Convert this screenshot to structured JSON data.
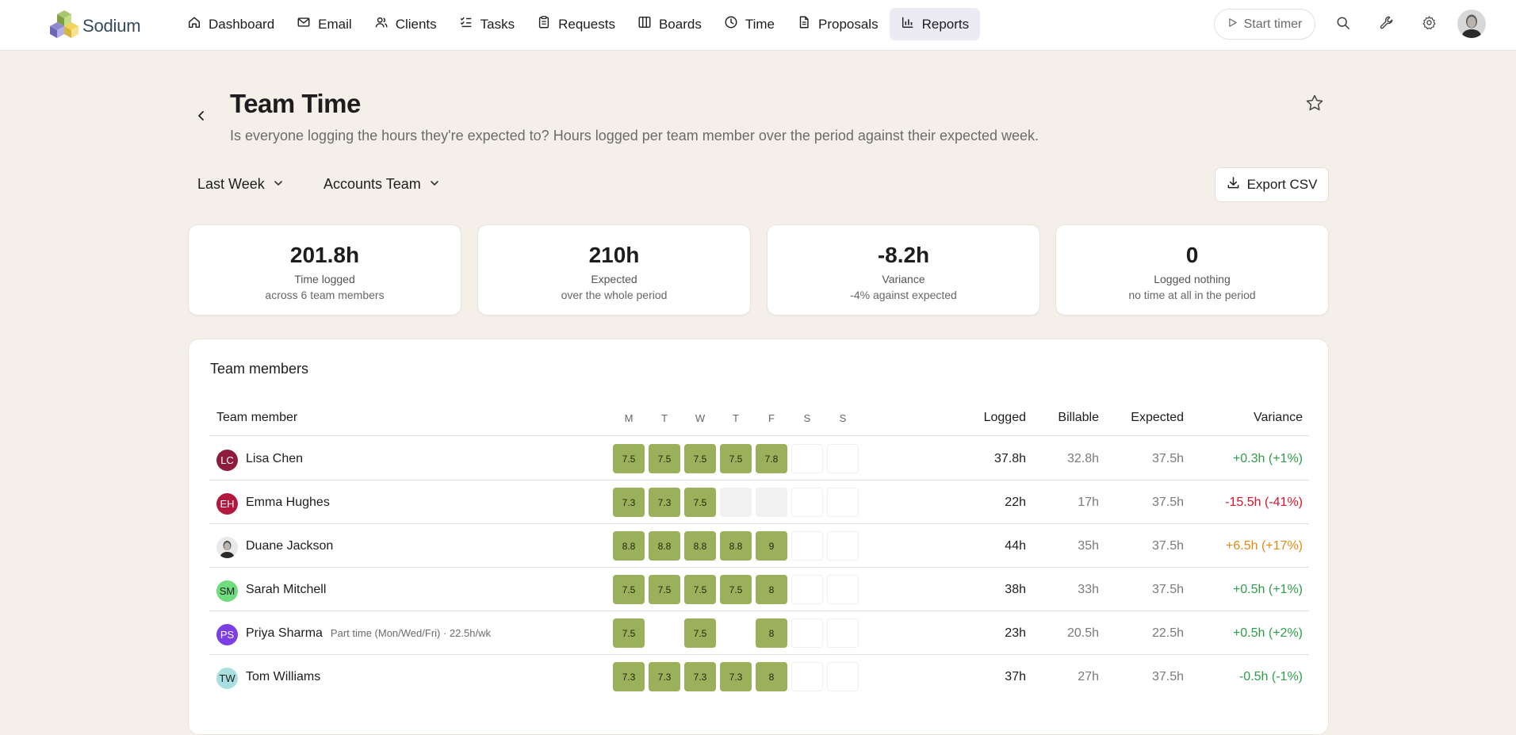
{
  "brand": {
    "name": "Sodium",
    "logo_icon": "cubes-logo-icon"
  },
  "nav": [
    {
      "label": "Dashboard",
      "icon": "home-icon"
    },
    {
      "label": "Email",
      "icon": "mail-icon"
    },
    {
      "label": "Clients",
      "icon": "users-icon"
    },
    {
      "label": "Tasks",
      "icon": "checklist-icon"
    },
    {
      "label": "Requests",
      "icon": "clipboard-icon"
    },
    {
      "label": "Boards",
      "icon": "columns-icon"
    },
    {
      "label": "Time",
      "icon": "clock-icon"
    },
    {
      "label": "Proposals",
      "icon": "document-icon"
    },
    {
      "label": "Reports",
      "icon": "bar-chart-icon",
      "active": true
    }
  ],
  "topbar": {
    "timer_label": "Start timer"
  },
  "header": {
    "title": "Team Time",
    "subtitle": "Is everyone logging the hours they're expected to? Hours logged per team member over the period against their expected week."
  },
  "filters": {
    "period": "Last Week",
    "team": "Accounts Team"
  },
  "export": {
    "label": "Export CSV"
  },
  "stats": [
    {
      "value": "201.8h",
      "label": "Time logged",
      "sub": "across 6 team members"
    },
    {
      "value": "210h",
      "label": "Expected",
      "sub": "over the whole period"
    },
    {
      "value": "-8.2h",
      "label": "Variance",
      "sub": "-4% against expected"
    },
    {
      "value": "0",
      "label": "Logged nothing",
      "sub": "no time at all in the period"
    }
  ],
  "table": {
    "title": "Team members",
    "headers": {
      "member": "Team member",
      "logged": "Logged",
      "billable": "Billable",
      "expected": "Expected",
      "variance": "Variance"
    },
    "days": [
      "M",
      "T",
      "W",
      "T",
      "F",
      "S",
      "S"
    ],
    "colors": {
      "positive": "#2e9e4a",
      "negative": "#d9142b",
      "warning": "#e08a16",
      "filled": "#9bb05b"
    },
    "rows": [
      {
        "initials": "LC",
        "avatar_color": "#8c1d3f",
        "name": "Lisa Chen",
        "note": "",
        "days": [
          "7.5",
          "7.5",
          "7.5",
          "7.5",
          "7.8",
          "",
          ""
        ],
        "day_state": [
          "f",
          "f",
          "f",
          "f",
          "f",
          "w",
          "w"
        ],
        "logged": "37.8h",
        "billable": "32.8h",
        "expected": "37.5h",
        "variance": "+0.3h (+1%)",
        "variance_tone": "positive"
      },
      {
        "initials": "EH",
        "avatar_color": "#b0183d",
        "name": "Emma Hughes",
        "note": "",
        "days": [
          "7.3",
          "7.3",
          "7.5",
          "",
          "",
          "",
          ""
        ],
        "day_state": [
          "f",
          "f",
          "f",
          "m",
          "m",
          "w",
          "w"
        ],
        "logged": "22h",
        "billable": "17h",
        "expected": "37.5h",
        "variance": "-15.5h (-41%)",
        "variance_tone": "negative"
      },
      {
        "initials": "",
        "avatar_color": "#ffffff",
        "photo": true,
        "name": "Duane Jackson",
        "note": "",
        "days": [
          "8.8",
          "8.8",
          "8.8",
          "8.8",
          "9",
          "",
          ""
        ],
        "day_state": [
          "f",
          "f",
          "f",
          "f",
          "f",
          "w",
          "w"
        ],
        "logged": "44h",
        "billable": "35h",
        "expected": "37.5h",
        "variance": "+6.5h (+17%)",
        "variance_tone": "warning"
      },
      {
        "initials": "SM",
        "avatar_color": "#6fdc7f",
        "name": "Sarah Mitchell",
        "note": "",
        "days": [
          "7.5",
          "7.5",
          "7.5",
          "7.5",
          "8",
          "",
          ""
        ],
        "day_state": [
          "f",
          "f",
          "f",
          "f",
          "f",
          "w",
          "w"
        ],
        "logged": "38h",
        "billable": "33h",
        "expected": "37.5h",
        "variance": "+0.5h (+1%)",
        "variance_tone": "positive"
      },
      {
        "initials": "PS",
        "avatar_color": "#7b3fe4",
        "name": "Priya Sharma",
        "note": "Part time (Mon/Wed/Fri) · 22.5h/wk",
        "days": [
          "7.5",
          "",
          "7.5",
          "",
          "8",
          "",
          ""
        ],
        "day_state": [
          "f",
          "e",
          "f",
          "e",
          "f",
          "w",
          "w"
        ],
        "logged": "23h",
        "billable": "20.5h",
        "expected": "22.5h",
        "variance": "+0.5h (+2%)",
        "variance_tone": "positive"
      },
      {
        "initials": "TW",
        "avatar_color": "#a8dfe0",
        "name": "Tom Williams",
        "note": "",
        "days": [
          "7.3",
          "7.3",
          "7.3",
          "7.3",
          "8",
          "",
          ""
        ],
        "day_state": [
          "f",
          "f",
          "f",
          "f",
          "f",
          "w",
          "w"
        ],
        "logged": "37h",
        "billable": "27h",
        "expected": "37.5h",
        "variance": "-0.5h (-1%)",
        "variance_tone": "positive"
      }
    ]
  }
}
